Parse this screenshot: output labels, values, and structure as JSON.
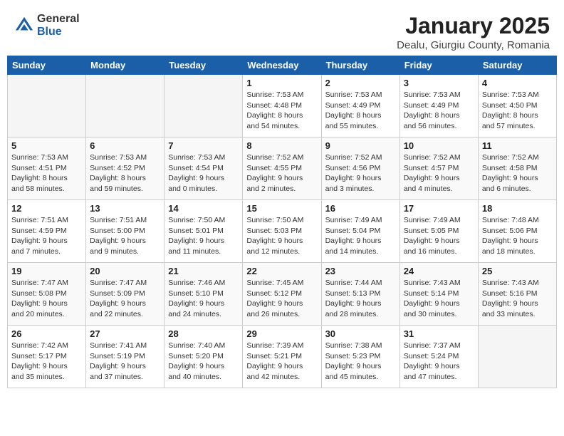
{
  "logo": {
    "general": "General",
    "blue": "Blue"
  },
  "header": {
    "title": "January 2025",
    "subtitle": "Dealu, Giurgiu County, Romania"
  },
  "weekdays": [
    "Sunday",
    "Monday",
    "Tuesday",
    "Wednesday",
    "Thursday",
    "Friday",
    "Saturday"
  ],
  "weeks": [
    [
      {
        "day": "",
        "sunrise": "",
        "sunset": "",
        "daylight": ""
      },
      {
        "day": "",
        "sunrise": "",
        "sunset": "",
        "daylight": ""
      },
      {
        "day": "",
        "sunrise": "",
        "sunset": "",
        "daylight": ""
      },
      {
        "day": "1",
        "sunrise": "Sunrise: 7:53 AM",
        "sunset": "Sunset: 4:48 PM",
        "daylight": "Daylight: 8 hours and 54 minutes."
      },
      {
        "day": "2",
        "sunrise": "Sunrise: 7:53 AM",
        "sunset": "Sunset: 4:49 PM",
        "daylight": "Daylight: 8 hours and 55 minutes."
      },
      {
        "day": "3",
        "sunrise": "Sunrise: 7:53 AM",
        "sunset": "Sunset: 4:49 PM",
        "daylight": "Daylight: 8 hours and 56 minutes."
      },
      {
        "day": "4",
        "sunrise": "Sunrise: 7:53 AM",
        "sunset": "Sunset: 4:50 PM",
        "daylight": "Daylight: 8 hours and 57 minutes."
      }
    ],
    [
      {
        "day": "5",
        "sunrise": "Sunrise: 7:53 AM",
        "sunset": "Sunset: 4:51 PM",
        "daylight": "Daylight: 8 hours and 58 minutes."
      },
      {
        "day": "6",
        "sunrise": "Sunrise: 7:53 AM",
        "sunset": "Sunset: 4:52 PM",
        "daylight": "Daylight: 8 hours and 59 minutes."
      },
      {
        "day": "7",
        "sunrise": "Sunrise: 7:53 AM",
        "sunset": "Sunset: 4:54 PM",
        "daylight": "Daylight: 9 hours and 0 minutes."
      },
      {
        "day": "8",
        "sunrise": "Sunrise: 7:52 AM",
        "sunset": "Sunset: 4:55 PM",
        "daylight": "Daylight: 9 hours and 2 minutes."
      },
      {
        "day": "9",
        "sunrise": "Sunrise: 7:52 AM",
        "sunset": "Sunset: 4:56 PM",
        "daylight": "Daylight: 9 hours and 3 minutes."
      },
      {
        "day": "10",
        "sunrise": "Sunrise: 7:52 AM",
        "sunset": "Sunset: 4:57 PM",
        "daylight": "Daylight: 9 hours and 4 minutes."
      },
      {
        "day": "11",
        "sunrise": "Sunrise: 7:52 AM",
        "sunset": "Sunset: 4:58 PM",
        "daylight": "Daylight: 9 hours and 6 minutes."
      }
    ],
    [
      {
        "day": "12",
        "sunrise": "Sunrise: 7:51 AM",
        "sunset": "Sunset: 4:59 PM",
        "daylight": "Daylight: 9 hours and 7 minutes."
      },
      {
        "day": "13",
        "sunrise": "Sunrise: 7:51 AM",
        "sunset": "Sunset: 5:00 PM",
        "daylight": "Daylight: 9 hours and 9 minutes."
      },
      {
        "day": "14",
        "sunrise": "Sunrise: 7:50 AM",
        "sunset": "Sunset: 5:01 PM",
        "daylight": "Daylight: 9 hours and 11 minutes."
      },
      {
        "day": "15",
        "sunrise": "Sunrise: 7:50 AM",
        "sunset": "Sunset: 5:03 PM",
        "daylight": "Daylight: 9 hours and 12 minutes."
      },
      {
        "day": "16",
        "sunrise": "Sunrise: 7:49 AM",
        "sunset": "Sunset: 5:04 PM",
        "daylight": "Daylight: 9 hours and 14 minutes."
      },
      {
        "day": "17",
        "sunrise": "Sunrise: 7:49 AM",
        "sunset": "Sunset: 5:05 PM",
        "daylight": "Daylight: 9 hours and 16 minutes."
      },
      {
        "day": "18",
        "sunrise": "Sunrise: 7:48 AM",
        "sunset": "Sunset: 5:06 PM",
        "daylight": "Daylight: 9 hours and 18 minutes."
      }
    ],
    [
      {
        "day": "19",
        "sunrise": "Sunrise: 7:47 AM",
        "sunset": "Sunset: 5:08 PM",
        "daylight": "Daylight: 9 hours and 20 minutes."
      },
      {
        "day": "20",
        "sunrise": "Sunrise: 7:47 AM",
        "sunset": "Sunset: 5:09 PM",
        "daylight": "Daylight: 9 hours and 22 minutes."
      },
      {
        "day": "21",
        "sunrise": "Sunrise: 7:46 AM",
        "sunset": "Sunset: 5:10 PM",
        "daylight": "Daylight: 9 hours and 24 minutes."
      },
      {
        "day": "22",
        "sunrise": "Sunrise: 7:45 AM",
        "sunset": "Sunset: 5:12 PM",
        "daylight": "Daylight: 9 hours and 26 minutes."
      },
      {
        "day": "23",
        "sunrise": "Sunrise: 7:44 AM",
        "sunset": "Sunset: 5:13 PM",
        "daylight": "Daylight: 9 hours and 28 minutes."
      },
      {
        "day": "24",
        "sunrise": "Sunrise: 7:43 AM",
        "sunset": "Sunset: 5:14 PM",
        "daylight": "Daylight: 9 hours and 30 minutes."
      },
      {
        "day": "25",
        "sunrise": "Sunrise: 7:43 AM",
        "sunset": "Sunset: 5:16 PM",
        "daylight": "Daylight: 9 hours and 33 minutes."
      }
    ],
    [
      {
        "day": "26",
        "sunrise": "Sunrise: 7:42 AM",
        "sunset": "Sunset: 5:17 PM",
        "daylight": "Daylight: 9 hours and 35 minutes."
      },
      {
        "day": "27",
        "sunrise": "Sunrise: 7:41 AM",
        "sunset": "Sunset: 5:19 PM",
        "daylight": "Daylight: 9 hours and 37 minutes."
      },
      {
        "day": "28",
        "sunrise": "Sunrise: 7:40 AM",
        "sunset": "Sunset: 5:20 PM",
        "daylight": "Daylight: 9 hours and 40 minutes."
      },
      {
        "day": "29",
        "sunrise": "Sunrise: 7:39 AM",
        "sunset": "Sunset: 5:21 PM",
        "daylight": "Daylight: 9 hours and 42 minutes."
      },
      {
        "day": "30",
        "sunrise": "Sunrise: 7:38 AM",
        "sunset": "Sunset: 5:23 PM",
        "daylight": "Daylight: 9 hours and 45 minutes."
      },
      {
        "day": "31",
        "sunrise": "Sunrise: 7:37 AM",
        "sunset": "Sunset: 5:24 PM",
        "daylight": "Daylight: 9 hours and 47 minutes."
      },
      {
        "day": "",
        "sunrise": "",
        "sunset": "",
        "daylight": ""
      }
    ]
  ]
}
